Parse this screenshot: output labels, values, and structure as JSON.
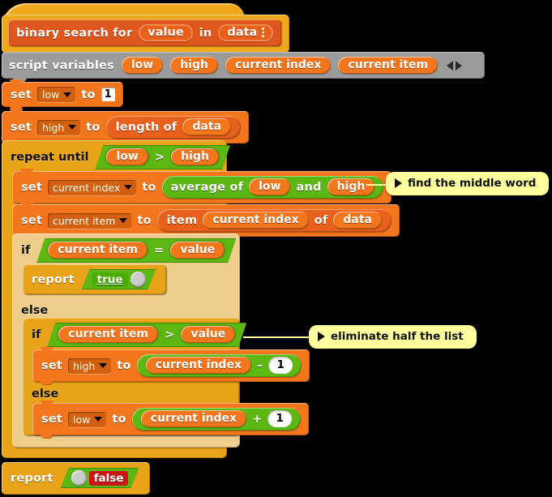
{
  "script": {
    "title": "binary search for value in data",
    "hat": {
      "label_before": "binary search for",
      "param_value": "value",
      "label_mid": "in",
      "param_data": "data",
      "data_variadic_icon": "vertical-ellipsis-icon"
    },
    "script_variables": {
      "label": "script variables",
      "vars": [
        "low",
        "high",
        "current index",
        "current item"
      ],
      "arrows_icon": "left-right-arrows-icon"
    },
    "statements": {
      "set_low_1": {
        "set": "set",
        "var": "low",
        "to": "to",
        "value": "1"
      },
      "set_high_length": {
        "set": "set",
        "var": "high",
        "to": "to",
        "reporter": "length of",
        "arg": "data"
      },
      "repeat_until": {
        "label": "repeat until",
        "left": "low",
        "op": ">",
        "right": "high"
      },
      "set_current_index": {
        "set": "set",
        "var": "current index",
        "to": "to",
        "reporter_prefix": "average of",
        "left": "low",
        "joiner": "and",
        "right": "high"
      },
      "set_current_item": {
        "set": "set",
        "var": "current item",
        "to": "to",
        "reporter_prefix": "item",
        "index": "current index",
        "of": "of",
        "list": "data"
      },
      "if_equal": {
        "label": "if",
        "left": "current item",
        "op": "=",
        "right": "value"
      },
      "report_true": {
        "label": "report",
        "value": "true"
      },
      "else_outer": {
        "label": "else"
      },
      "if_greater": {
        "label": "if",
        "left": "current item",
        "op": ">",
        "right": "value"
      },
      "set_high_minus": {
        "set": "set",
        "var": "high",
        "to": "to",
        "left": "current index",
        "op": "–",
        "right": "1"
      },
      "else_inner": {
        "label": "else"
      },
      "set_low_plus": {
        "set": "set",
        "var": "low",
        "to": "to",
        "left": "current index",
        "op": "+",
        "right": "1"
      },
      "report_false": {
        "label": "report",
        "value": "false"
      }
    },
    "comments": [
      {
        "text": "find the middle word",
        "collapse_icon": "triangle-right-icon"
      },
      {
        "text": "eliminate half the list",
        "collapse_icon": "triangle-right-icon"
      }
    ],
    "colors": {
      "variables_orange": "#f3761d",
      "operators_green": "#5cb712",
      "control_gold": "#e8a318",
      "control_light": "#efce8c",
      "hat_yellow": "#f0a81b",
      "prototype_red": "#e0571d",
      "other_gray": "#9b9b9b",
      "comment_yellow": "#ffff9e",
      "false_red": "#cc1616",
      "background": "#000000"
    }
  }
}
